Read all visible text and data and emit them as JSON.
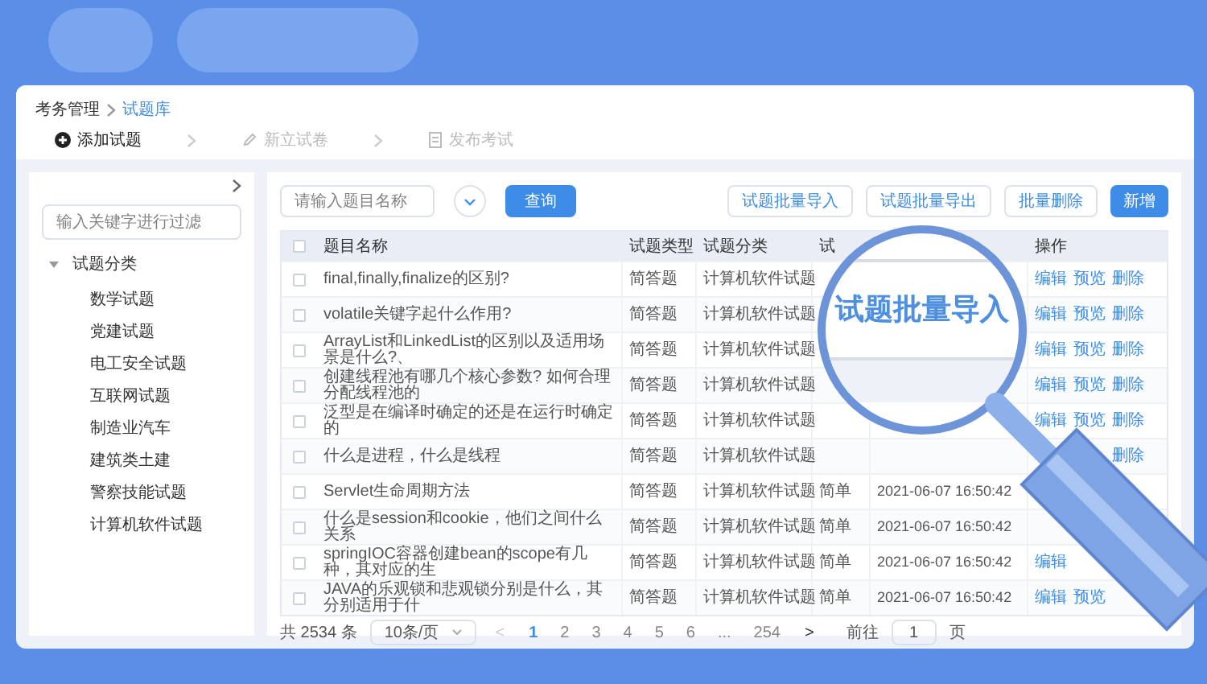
{
  "breadcrumb": [
    {
      "label": "考务管理",
      "selected": false
    },
    {
      "label": "试题库",
      "selected": true
    }
  ],
  "steps": [
    {
      "label": "添加试题",
      "selected": true,
      "kind": "add"
    },
    {
      "label": "新立试卷",
      "selected": false,
      "kind": "edit"
    },
    {
      "label": "发布考试",
      "selected": false,
      "kind": "publish"
    }
  ],
  "sidebar": {
    "search": {
      "placeholder": "输入关键字进行过滤"
    },
    "tree": [
      {
        "label": "试题分类",
        "expanded": true,
        "children": [
          {
            "label": "数学试题"
          },
          {
            "label": "党建试题"
          },
          {
            "label": "电工安全试题"
          },
          {
            "label": "互联网试题"
          },
          {
            "label": "制造业汽车"
          },
          {
            "label": "建筑类土建"
          },
          {
            "label": "警察技能试题"
          },
          {
            "label": "计算机软件试题"
          }
        ]
      }
    ]
  },
  "toolbar": {
    "search": {
      "placeholder": "请输入题目名称"
    },
    "query_button": "查询",
    "buttons": [
      {
        "label": "试题批量导入",
        "kind": "outline"
      },
      {
        "label": "试题批量导出",
        "kind": "outline"
      },
      {
        "label": "批量删除",
        "kind": "outline"
      },
      {
        "label": "新增",
        "kind": "primary"
      }
    ]
  },
  "table": {
    "all_checked": false,
    "columns": [
      {
        "label": "题目名称"
      },
      {
        "label": "试题类型"
      },
      {
        "label": "试题分类"
      },
      {
        "label": "试"
      },
      {},
      {
        "label": "操作"
      }
    ],
    "rows": [
      {
        "checked": false,
        "name": "final,finally,finalize的区别?",
        "type": "简答题",
        "category": "计算机软件试题",
        "actions": [
          {
            "label": "编辑",
            "kind": "edit"
          },
          {
            "label": "预览",
            "kind": "preview"
          },
          {
            "label": "删除",
            "kind": "delete"
          }
        ]
      },
      {
        "checked": false,
        "name": "volatile关键字起什么作用?",
        "type": "简答题",
        "category": "计算机软件试题",
        "actions": [
          {
            "label": "编辑",
            "kind": "edit"
          },
          {
            "label": "预览",
            "kind": "preview"
          },
          {
            "label": "删除",
            "kind": "delete"
          }
        ]
      },
      {
        "checked": false,
        "name": "ArrayList和LinkedList的区别以及适用场景是什么?、",
        "type": "简答题",
        "category": "计算机软件试题",
        "actions": [
          {
            "label": "编辑",
            "kind": "edit"
          },
          {
            "label": "预览",
            "kind": "preview"
          },
          {
            "label": "删除",
            "kind": "delete"
          }
        ]
      },
      {
        "checked": false,
        "name": "创建线程池有哪几个核心参数? 如何合理分配线程池的",
        "type": "简答题",
        "category": "计算机软件试题",
        "actions": [
          {
            "label": "编辑",
            "kind": "edit"
          },
          {
            "label": "预览",
            "kind": "preview"
          },
          {
            "label": "删除",
            "kind": "delete"
          }
        ]
      },
      {
        "checked": false,
        "name": "泛型是在编译时确定的还是在运行时确定的",
        "type": "简答题",
        "category": "计算机软件试题",
        "actions": [
          {
            "label": "编辑",
            "kind": "edit"
          },
          {
            "label": "预览",
            "kind": "preview"
          },
          {
            "label": "删除",
            "kind": "delete"
          }
        ]
      },
      {
        "checked": false,
        "name": "什么是进程，什么是线程",
        "type": "简答题",
        "category": "计算机软件试题",
        "actions": [
          {
            "label": "删除",
            "kind": "delete"
          }
        ]
      },
      {
        "checked": false,
        "name": "Servlet生命周期方法",
        "type": "简答题",
        "category": "计算机软件试题",
        "column_4": "简单",
        "column_5": "2021-06-07 16:50:42",
        "actions": []
      },
      {
        "checked": false,
        "name": "什么是session和cookie，他们之间什么关系",
        "type": "简答题",
        "category": "计算机软件试题",
        "column_4": "简单",
        "column_5": "2021-06-07 16:50:42",
        "actions": []
      },
      {
        "checked": false,
        "name": "springIOC容器创建bean的scope有几种，其对应的生",
        "type": "简答题",
        "category": "计算机软件试题",
        "column_4": "简单",
        "column_5": "2021-06-07 16:50:42",
        "actions": [
          {
            "label": "编辑",
            "kind": "edit"
          }
        ]
      },
      {
        "checked": false,
        "name": "JAVA的乐观锁和悲观锁分别是什么，其分别适用于什",
        "type": "简答题",
        "category": "计算机软件试题",
        "column_4": "简单",
        "column_5": "2021-06-07 16:50:42",
        "actions": [
          {
            "label": "编辑",
            "kind": "edit"
          },
          {
            "label": "预览",
            "kind": "preview"
          }
        ]
      }
    ]
  },
  "pagination": {
    "total": "共 2534 条",
    "page_size": "10条/页",
    "prev": {
      "label": "<",
      "disabled": true
    },
    "pages": [
      {
        "label": "1",
        "selected": true
      },
      {
        "label": "2",
        "selected": false
      },
      {
        "label": "3",
        "selected": false
      },
      {
        "label": "4",
        "selected": false
      },
      {
        "label": "5",
        "selected": false
      },
      {
        "label": "6",
        "selected": false
      },
      {
        "label": "...",
        "selected": false
      },
      {
        "label": "254",
        "selected": false
      }
    ],
    "next": {
      "label": ">",
      "disabled": false
    },
    "goto_label": "前往",
    "goto_value": "1",
    "goto_suffix": "页"
  },
  "magnifier": {
    "text": "试题批量导入"
  }
}
